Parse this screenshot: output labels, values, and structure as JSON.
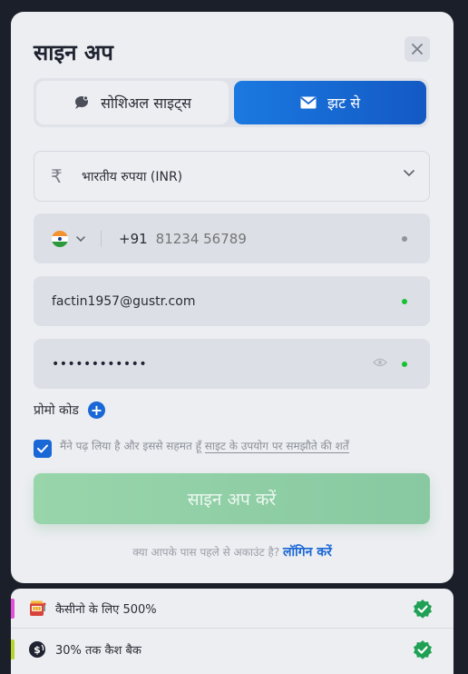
{
  "modal": {
    "title": "साइन अप",
    "tabs": [
      {
        "label": "सोशिअल साइट्स",
        "active": false,
        "icon": "chat-bubble-icon"
      },
      {
        "label": "झट से",
        "active": true,
        "icon": "envelope-icon"
      }
    ],
    "currency": {
      "symbol": "₹",
      "label": "भारतीय रुपया (INR)"
    },
    "phone": {
      "country": "India",
      "code": "+91",
      "placeholder": "81234 56789"
    },
    "email": {
      "value": "factin1957@gustr.com"
    },
    "password": {
      "value": "••••••••••••"
    },
    "promo": {
      "label": "प्रोमो कोड",
      "add": "+"
    },
    "agreement": {
      "text": "मैंने पढ़ लिया है और इससे सहमत हूँ",
      "link": "साइट के उपयोग पर समझौते की शर्तें",
      "checked": true
    },
    "submit": {
      "label": "साइन अप करें"
    },
    "login": {
      "prompt": "क्या आपके पास पहले से अकाउंट है?",
      "link": "लॉगिन करें"
    }
  },
  "bonuses": [
    {
      "icon": "slot-machine-icon",
      "label": "कैसीनो के लिए 500%",
      "accent": "#e04fd8"
    },
    {
      "icon": "cashback-coin-icon",
      "label": "30% तक कैश बैक",
      "accent": "#b7d42a"
    }
  ],
  "colors": {
    "primary": "#1a67d6",
    "valid_dot": "#17c230",
    "submit_bg": "#93d0a7",
    "badge_green": "#1fa055"
  }
}
